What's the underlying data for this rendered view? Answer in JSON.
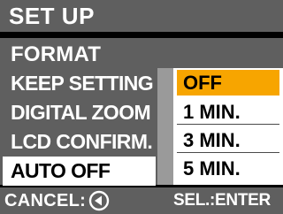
{
  "header": {
    "title": "SET UP"
  },
  "menu": {
    "items": [
      {
        "label": "FORMAT"
      },
      {
        "label": "KEEP SETTING"
      },
      {
        "label": "DIGITAL ZOOM"
      },
      {
        "label": "LCD CONFIRM."
      },
      {
        "label": "AUTO OFF",
        "selected": true
      }
    ]
  },
  "submenu": {
    "options": [
      {
        "label": "OFF",
        "selected": true
      },
      {
        "label": "1 MIN."
      },
      {
        "label": "3 MIN."
      },
      {
        "label": "5 MIN."
      }
    ]
  },
  "footer": {
    "cancel_label": "CANCEL:",
    "cancel_icon": "left-arrow-circle-icon",
    "select_label": "SEL.:ENTER"
  },
  "colors": {
    "panel": "#5f5f5f",
    "highlight": "#f7a500",
    "stripe": "#9a9a9a"
  }
}
